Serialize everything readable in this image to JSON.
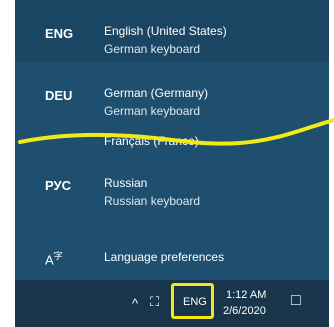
{
  "languages": [
    {
      "code": "ENG",
      "name": "English (United States)",
      "layout": "German keyboard"
    },
    {
      "code": "DEU",
      "name": "German (Germany)",
      "layout": "German keyboard"
    },
    {
      "code": "",
      "name": "Français (France)",
      "layout": ""
    },
    {
      "code": "РУС",
      "name": "Russian",
      "layout": "Russian keyboard"
    }
  ],
  "preferences": {
    "label": "Language preferences",
    "icon": "language-settings-icon"
  },
  "taskbar": {
    "ime_indicator": "ENG",
    "time": "1:12 AM",
    "date": "2/6/2020",
    "chevron_icon": "chevron-up-icon",
    "ime_mode_icon": "input-method-icon",
    "notification_icon": "action-center-icon"
  },
  "colors": {
    "flyout_bg": "#1e4f6f",
    "taskbar_bg": "#18354b",
    "highlight": "#f1ea16"
  }
}
